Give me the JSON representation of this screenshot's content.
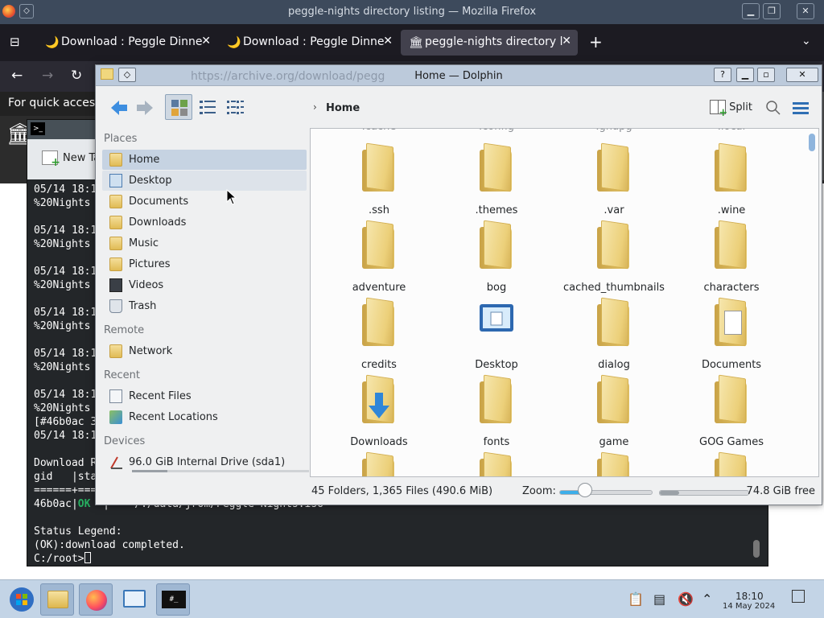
{
  "firefox": {
    "window_title": "peggle-nights directory listing — Mozilla Firefox",
    "tabs": [
      {
        "label": "Download : Peggle Dinne"
      },
      {
        "label": "Download : Peggle Dinne"
      },
      {
        "label": "peggle-nights directory l"
      }
    ],
    "new_tab": "+",
    "notice": "For quick access",
    "url": "https://archive.org/download/pegg"
  },
  "terminal": {
    "toolbar_new": "New Ta",
    "lines": [
      "05/14 18:1",
      "%20Nights",
      "",
      "05/14 18:1",
      "%20Nights",
      "",
      "05/14 18:1",
      "%20Nights",
      "",
      "05/14 18:1",
      "%20Nights",
      "",
      "05/14 18:1",
      "%20Nights",
      "",
      "05/14 18:1",
      "%20Nights",
      "[#46b0ac 3",
      "05/14 18:1",
      "",
      "Download R",
      "gid   |sta",
      "======+===",
      "46b0ac|"
    ],
    "ok_label": "OK",
    "ok_rest": "  |    /./data/jrom/Peggle Nights.iso",
    "legend_title": "Status Legend:",
    "legend_ok": "(OK):download completed.",
    "prompt": "C:/root>"
  },
  "dolphin": {
    "title": "Home — Dolphin",
    "breadcrumb": "Home",
    "split_label": "Split",
    "sections": {
      "places": "Places",
      "remote": "Remote",
      "recent": "Recent",
      "devices": "Devices"
    },
    "places": [
      "Home",
      "Desktop",
      "Documents",
      "Downloads",
      "Music",
      "Pictures",
      "Videos",
      "Trash"
    ],
    "remote": [
      "Network"
    ],
    "recent": [
      "Recent Files",
      "Recent Locations"
    ],
    "devices": [
      {
        "label": "96.0 GiB Internal Drive (sda1)",
        "used_fraction": 0.2
      }
    ],
    "partial_row": [
      ".cache",
      ".config",
      ".gnupg",
      ".local"
    ],
    "files": [
      ".ssh",
      ".themes",
      ".var",
      ".wine",
      "adventure",
      "bog",
      "cached_thumbnails",
      "characters",
      "credits",
      "Desktop",
      "dialog",
      "Documents",
      "Downloads",
      "fonts",
      "game",
      "GOG Games"
    ],
    "status_count": "45 Folders, 1,365 Files (490.6 MiB)",
    "zoom_label": "Zoom:",
    "zoom_fraction": 0.28,
    "free_label": "74.8 GiB free",
    "used_fraction": 0.22
  },
  "taskbar": {
    "time": "18:10",
    "date": "14 May 2024"
  }
}
